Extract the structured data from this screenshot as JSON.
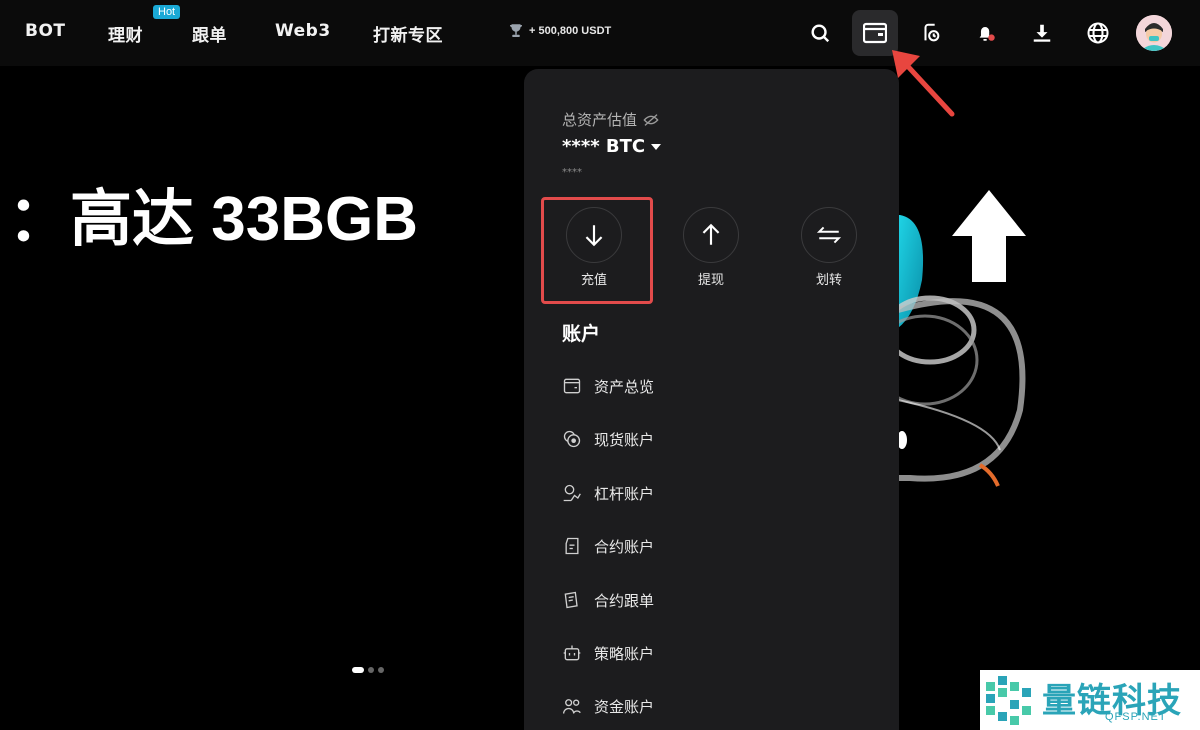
{
  "nav": {
    "items": [
      "BOT",
      "理财",
      "跟单",
      "Web3",
      "打新专区"
    ],
    "hot_badge": "Hot",
    "reward_text": "+ 500,800 USDT"
  },
  "icons": [
    "search-icon",
    "wallet-icon",
    "order-history-icon",
    "bell-icon",
    "download-icon",
    "globe-icon"
  ],
  "hero": {
    "title": "：高达 33BGB"
  },
  "panel": {
    "asset_label": "总资产估值",
    "asset_value": "**** BTC",
    "asset_sub": "****",
    "actions": [
      {
        "label": "充值",
        "icon": "arrow-down-icon"
      },
      {
        "label": "提现",
        "icon": "arrow-up-icon"
      },
      {
        "label": "划转",
        "icon": "transfer-icon"
      }
    ],
    "section_title": "账户",
    "menu": [
      {
        "label": "资产总览",
        "icon": "wallet-outline-icon"
      },
      {
        "label": "现货账户",
        "icon": "coins-icon"
      },
      {
        "label": "杠杆账户",
        "icon": "margin-icon"
      },
      {
        "label": "合约账户",
        "icon": "contract-icon"
      },
      {
        "label": "合约跟单",
        "icon": "copy-trade-icon"
      },
      {
        "label": "策略账户",
        "icon": "bot-icon"
      },
      {
        "label": "资金账户",
        "icon": "users-icon"
      }
    ]
  },
  "watermark": {
    "title": "量链科技",
    "sub": "QFSP.NET"
  },
  "colors": {
    "accent_highlight": "#e24b4b",
    "hot_badge": "#1aa9d6",
    "panel_bg": "#1c1c1e",
    "watermark_text": "#2aa4b8"
  }
}
